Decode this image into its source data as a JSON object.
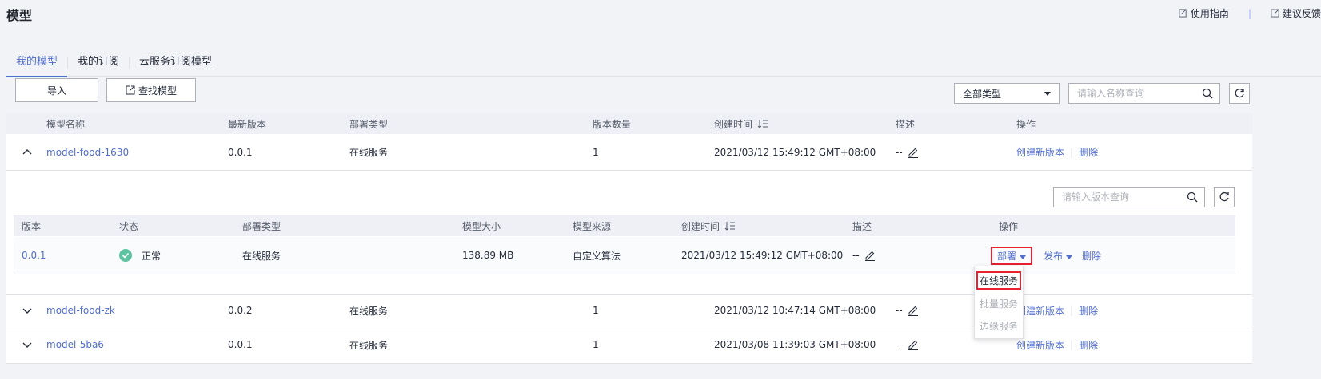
{
  "page": {
    "title": "模型"
  },
  "top_links": {
    "guide": "使用指南",
    "feedback": "建议反馈"
  },
  "tabs": [
    {
      "label": "我的模型",
      "active": true
    },
    {
      "label": "我的订阅",
      "active": false
    },
    {
      "label": "云服务订阅模型",
      "active": false
    }
  ],
  "toolbar": {
    "import_label": "导入",
    "find_label": "查找模型",
    "type_select": "全部类型",
    "search_placeholder": "请输入名称查询"
  },
  "columns": {
    "name": "模型名称",
    "latest_version": "最新版本",
    "deploy_type": "部署类型",
    "version_count": "版本数量",
    "created": "创建时间",
    "desc": "描述",
    "ops": "操作"
  },
  "models": [
    {
      "name": "model-food-1630",
      "version": "0.0.1",
      "deploy_type": "在线服务",
      "count": "1",
      "created": "2021/03/12 15:49:12 GMT+08:00",
      "desc": "--",
      "ops": [
        "创建新版本",
        "删除"
      ],
      "expanded": true
    },
    {
      "name": "model-food-zk",
      "version": "0.0.2",
      "deploy_type": "在线服务",
      "count": "1",
      "created": "2021/03/12 10:47:14 GMT+08:00",
      "desc": "--",
      "ops": [
        "创建新版本",
        "删除"
      ],
      "expanded": false
    },
    {
      "name": "model-5ba6",
      "version": "0.0.1",
      "deploy_type": "在线服务",
      "count": "1",
      "created": "2021/03/08 11:39:03 GMT+08:00",
      "desc": "--",
      "ops": [
        "创建新版本",
        "删除"
      ],
      "expanded": false
    }
  ],
  "version_panel": {
    "search_placeholder": "请输入版本查询",
    "columns": {
      "version": "版本",
      "status": "状态",
      "deploy_type": "部署类型",
      "size": "模型大小",
      "source": "模型来源",
      "created": "创建时间",
      "desc": "描述",
      "ops": "操作"
    },
    "rows": [
      {
        "version": "0.0.1",
        "status": "正常",
        "deploy_type": "在线服务",
        "size": "138.89 MB",
        "source": "自定义算法",
        "created": "2021/03/12 15:49:12 GMT+08:00",
        "desc": "--",
        "deploy": "部署",
        "publish": "发布",
        "delete": "删除"
      }
    ]
  },
  "deploy_menu": {
    "items": [
      {
        "label": "在线服务",
        "enabled": true,
        "highlighted": true
      },
      {
        "label": "批量服务",
        "enabled": false
      },
      {
        "label": "边缘服务",
        "enabled": false
      }
    ]
  },
  "colors": {
    "accent": "#526ecc",
    "highlight": "#e8202f",
    "status_ok": "#5dc3a0"
  }
}
